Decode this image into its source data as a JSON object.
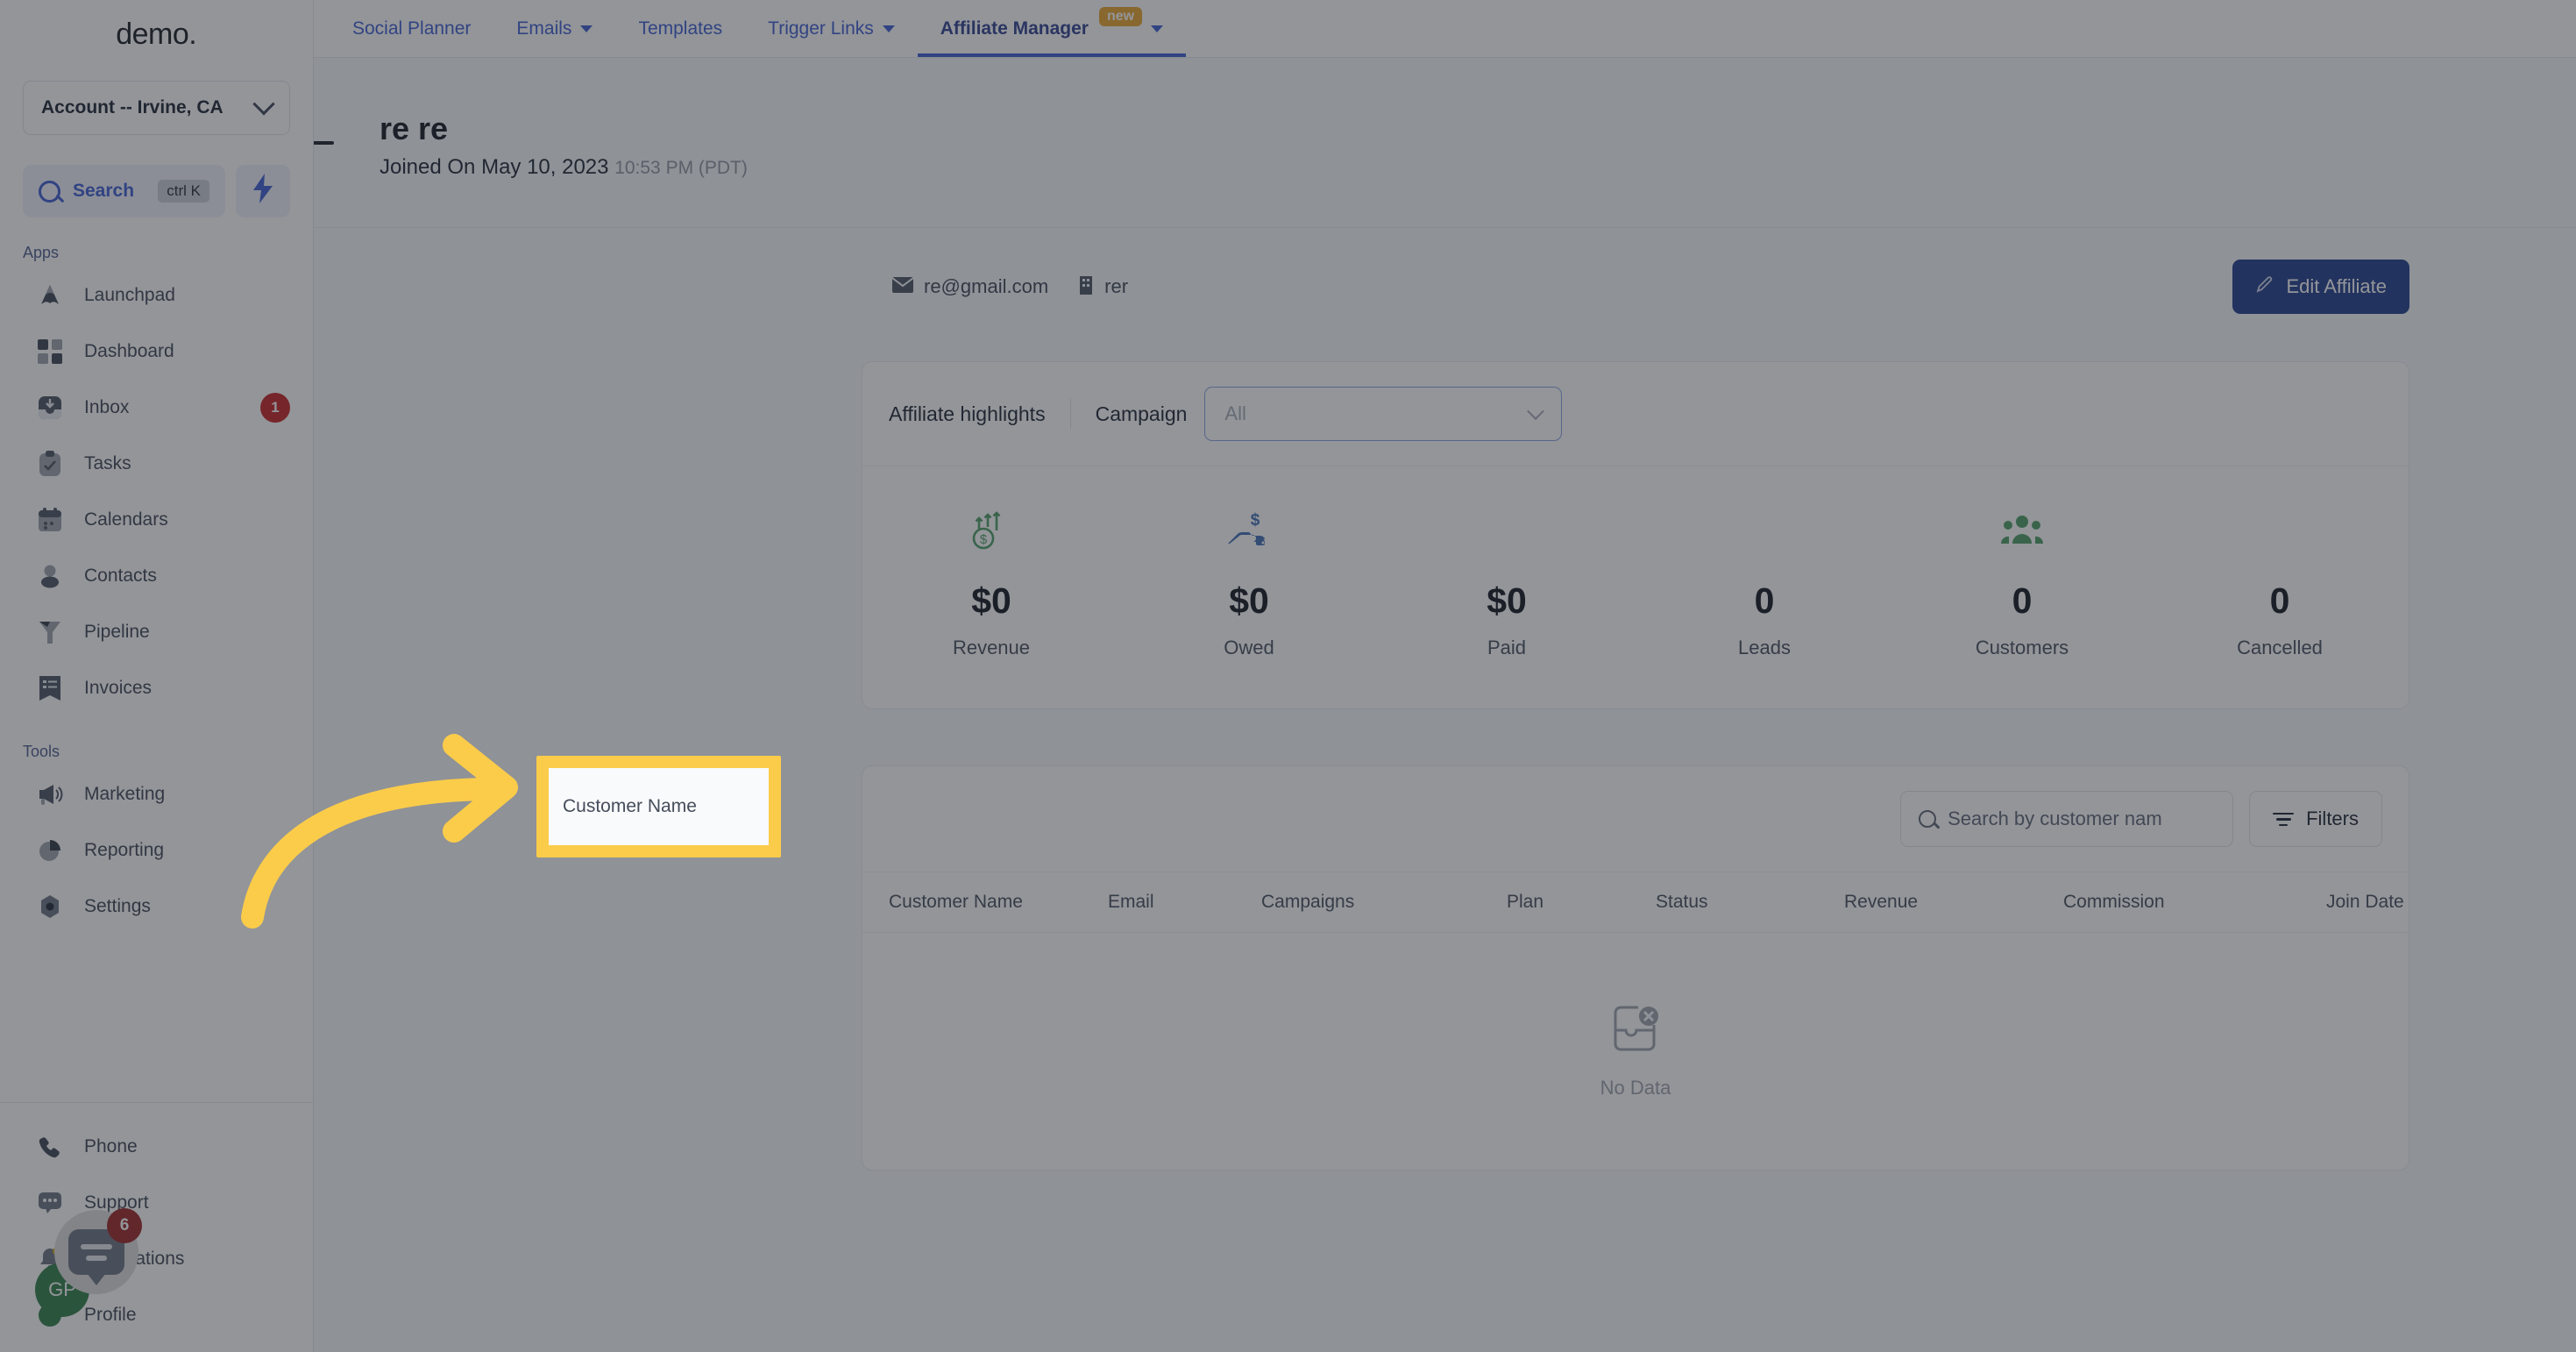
{
  "sidebar": {
    "brand": "demo",
    "brand_dot": ".",
    "account": {
      "label": "Account -- Irvine, CA",
      "chevron_icon": "chevron-down-icon"
    },
    "search": {
      "label": "Search",
      "shortcut": "ctrl K",
      "icon": "search-icon"
    },
    "bolt": {
      "icon": "lightning-bolt-icon",
      "glyph": "⚡"
    },
    "sections": [
      {
        "title": "Apps",
        "items": [
          {
            "label": "Launchpad",
            "icon": "launchpad-icon",
            "badge": null
          },
          {
            "label": "Dashboard",
            "icon": "dashboard-grid-icon",
            "badge": null
          },
          {
            "label": "Inbox",
            "icon": "inbox-icon",
            "badge": "1"
          },
          {
            "label": "Tasks",
            "icon": "tasks-clipboard-icon",
            "badge": null
          },
          {
            "label": "Calendars",
            "icon": "calendar-icon",
            "badge": null
          },
          {
            "label": "Contacts",
            "icon": "contacts-person-icon",
            "badge": null
          },
          {
            "label": "Pipeline",
            "icon": "pipeline-funnel-icon",
            "badge": null
          },
          {
            "label": "Invoices",
            "icon": "invoices-list-icon",
            "badge": null
          }
        ]
      },
      {
        "title": "Tools",
        "items": [
          {
            "label": "Marketing",
            "icon": "megaphone-icon",
            "badge": null
          },
          {
            "label": "Reporting",
            "icon": "pie-chart-icon",
            "badge": null
          },
          {
            "label": "Settings",
            "icon": "gear-icon",
            "badge": null
          }
        ]
      }
    ],
    "bottom_items": [
      {
        "label": "Phone",
        "icon": "phone-icon"
      },
      {
        "label": "Support",
        "icon": "chat-dots-icon"
      },
      {
        "label": "Notifications",
        "icon": "bell-icon"
      },
      {
        "label": "Profile",
        "icon": "avatar-icon"
      }
    ]
  },
  "topbar": {
    "menu_icon": "hamburger-menu-icon",
    "tabs": [
      {
        "label": "Social Planner",
        "caret": false,
        "badge": null,
        "active": false
      },
      {
        "label": "Emails",
        "caret": true,
        "badge": null,
        "active": false
      },
      {
        "label": "Templates",
        "caret": false,
        "badge": null,
        "active": false
      },
      {
        "label": "Trigger Links",
        "caret": true,
        "badge": null,
        "active": false
      },
      {
        "label": "Affiliate Manager",
        "caret": true,
        "badge": "new",
        "active": true
      }
    ]
  },
  "affiliate": {
    "back_icon": "back-arrow-icon",
    "name": "re re",
    "joined_label": "Joined On May 10, 2023",
    "joined_time": "10:53 PM (PDT)",
    "email": "re@gmail.com",
    "email_icon": "envelope-icon",
    "company": "rer",
    "company_icon": "building-icon",
    "edit_button": {
      "label": "Edit Affiliate",
      "icon": "pencil-icon"
    }
  },
  "highlights": {
    "title": "Affiliate highlights",
    "campaign_label": "Campaign",
    "campaign_value": "All",
    "campaign_chevron": "chevron-down-icon",
    "stats": [
      {
        "value": "$0",
        "label": "Revenue",
        "icon": "revenue-growth-icon",
        "color": "#4a9c62"
      },
      {
        "value": "$0",
        "label": "Owed",
        "icon": "hand-money-icon",
        "color": "#3f6cb5"
      },
      {
        "value": "$0",
        "label": "Paid",
        "icon": "none",
        "color": ""
      },
      {
        "value": "0",
        "label": "Leads",
        "icon": "none",
        "color": ""
      },
      {
        "value": "0",
        "label": "Customers",
        "icon": "customers-group-icon",
        "color": "#4a9c62"
      },
      {
        "value": "0",
        "label": "Cancelled",
        "icon": "none",
        "color": ""
      }
    ]
  },
  "customers_table": {
    "search_placeholder": "Search by customer nam",
    "search_value": "",
    "search_icon": "search-icon",
    "filters_button": {
      "label": "Filters",
      "icon": "filter-icon"
    },
    "columns": [
      "Customer Name",
      "Email",
      "Campaigns",
      "Plan",
      "Status",
      "Revenue",
      "Commission",
      "Join Date"
    ],
    "rows": [],
    "empty_state": {
      "text": "No Data",
      "icon": "no-data-inbox-icon"
    }
  },
  "annotation": {
    "highlight_text": "Customer Name",
    "highlight_color": "#fbcc4a",
    "arrow_icon": "curved-arrow-right-icon",
    "arrow_color": "#fbcc4a"
  },
  "chat_widget": {
    "icon": "chat-bubble-icon",
    "badge": "6",
    "avatar_initials": "GP"
  }
}
